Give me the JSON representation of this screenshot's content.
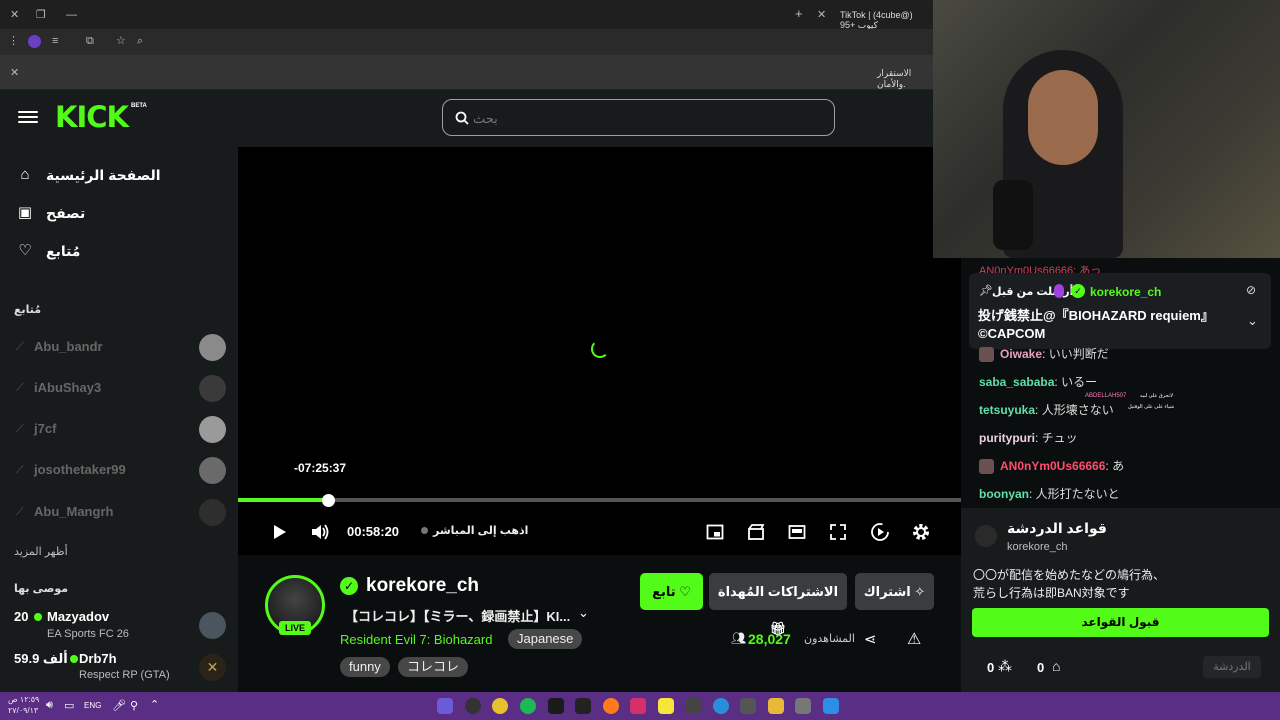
{
  "browser": {
    "tab_title": "TikTok | (4cube@) كيوب +95",
    "info_text": "الاستقرار والأمان."
  },
  "header": {
    "logo": "KICK",
    "beta": "BETA",
    "search_placeholder": "بحث"
  },
  "sidebar": {
    "nav": [
      {
        "label": "الصفحة الرئيسية",
        "icon": "home-icon"
      },
      {
        "label": "تصفح",
        "icon": "browse-icon"
      },
      {
        "label": "مُتابع",
        "icon": "heart-icon"
      }
    ],
    "following_title": "مُتابع",
    "following": [
      "Abu_bandr",
      "iAbuShay3",
      "j7cf",
      "josothetaker99",
      "Abu_Mangrh"
    ],
    "show_more": "أظهر المزيد",
    "recommended_title": "موصى بها",
    "recommended": [
      {
        "name": "Mazyadov",
        "game": "EA Sports FC 26",
        "viewers": "20"
      },
      {
        "name": "Drb7h",
        "game": "Respect RP (GTA)",
        "viewers": "59.9 ألف"
      }
    ]
  },
  "player": {
    "hover_time": "-07:25:37",
    "current_time": "00:58:20",
    "go_live": "اذهب إلى المباشر",
    "progress_fraction": 0.125
  },
  "stream": {
    "channel": "korekore_ch",
    "live": "LIVE",
    "title": "【コレコレ】【ミラー、録画禁止】KI...",
    "game": "Resident Evil 7: Biohazard",
    "tags": [
      "Japanese",
      "funny",
      "コレコレ"
    ],
    "follow_label": "تابع",
    "gift_label": "الاشتراكات المُهداة",
    "subscribe_label": "اشتراك",
    "viewers": "28,027",
    "viewers_label": "المشاهدون"
  },
  "chat": {
    "top_partial": "AN0nYm0Us66666: あっ",
    "pinned": {
      "pinned_by": "أرسلت من قبل",
      "user": "korekore_ch",
      "text": "投げ銭禁止@『BIOHAZARD requiem』©CAPCOM"
    },
    "messages": [
      {
        "user": "Oiwake",
        "text": "いい判断だ",
        "color": "#e8a0c0"
      },
      {
        "user": "saba_sababa",
        "text": "いるー",
        "color": "#5fe0a8"
      },
      {
        "user": "tetsuyuka",
        "text": "人形壊さない",
        "color": "#5fe0a8"
      },
      {
        "user": "puritypuri",
        "text": "チュッ",
        "color": "#f0d0e0"
      },
      {
        "user": "AN0nYm0Us66666",
        "text": "あ",
        "color": "#ff4d6d"
      },
      {
        "user": "boonyan",
        "text": "人形打たないと",
        "color": "#5fe0a8"
      }
    ],
    "overlay_small_user": "ABDELLAH507",
    "overlay_small_1": "لاتحرق على لبيه",
    "overlay_small_2": "شياء على على الوقتيل",
    "rules_title": "قواعد الدردشة",
    "rules_user": "korekore_ch",
    "rules_text_1": "〇〇が配信を始めたなどの鳩行為、",
    "rules_text_2": "荒らし行為は即BAN対象です",
    "accept_label": "قبول القواعد",
    "count_a": "0",
    "count_b": "0",
    "chat_placeholder": "الدردشة"
  },
  "taskbar": {
    "lang": "ENG",
    "time": "١٢:٥٩ ص",
    "date": "٢٧/٠٩/١٣"
  },
  "colors": {
    "accent": "#53fc18",
    "taskbar": "#5b2e86"
  }
}
